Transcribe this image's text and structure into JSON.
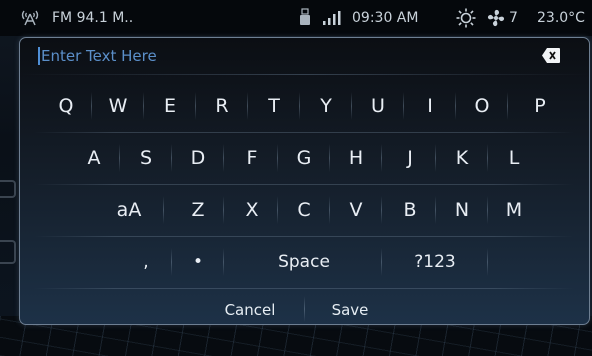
{
  "status_bar": {
    "radio_icon": "radio-antenna-icon",
    "radio_label": "FM  94.1 M..",
    "usb_icon": "usb-icon",
    "signal_icon": "signal-bars-icon",
    "clock": "09:30 AM",
    "sun_icon": "sun-icon",
    "fan_icon": "fan-icon",
    "fan_level": "7",
    "temperature": "23.0°C"
  },
  "text_field": {
    "value": "",
    "placeholder": "Enter Text Here",
    "backspace_icon": "backspace-icon"
  },
  "keyboard": {
    "row1": [
      "Q",
      "W",
      "E",
      "R",
      "T",
      "Y",
      "U",
      "I",
      "O",
      "P"
    ],
    "row2": [
      "A",
      "S",
      "D",
      "F",
      "G",
      "H",
      "J",
      "K",
      "L"
    ],
    "row3": [
      "aA",
      "Z",
      "X",
      "C",
      "V",
      "B",
      "N",
      "M"
    ],
    "row4": [
      ",",
      "•",
      "Space",
      "?123"
    ]
  },
  "actions": {
    "cancel_label": "Cancel",
    "save_label": "Save"
  },
  "colors": {
    "placeholder": "#5b8fc9",
    "panel_border": "#6e7f92",
    "key_text": "#e9eef4"
  }
}
